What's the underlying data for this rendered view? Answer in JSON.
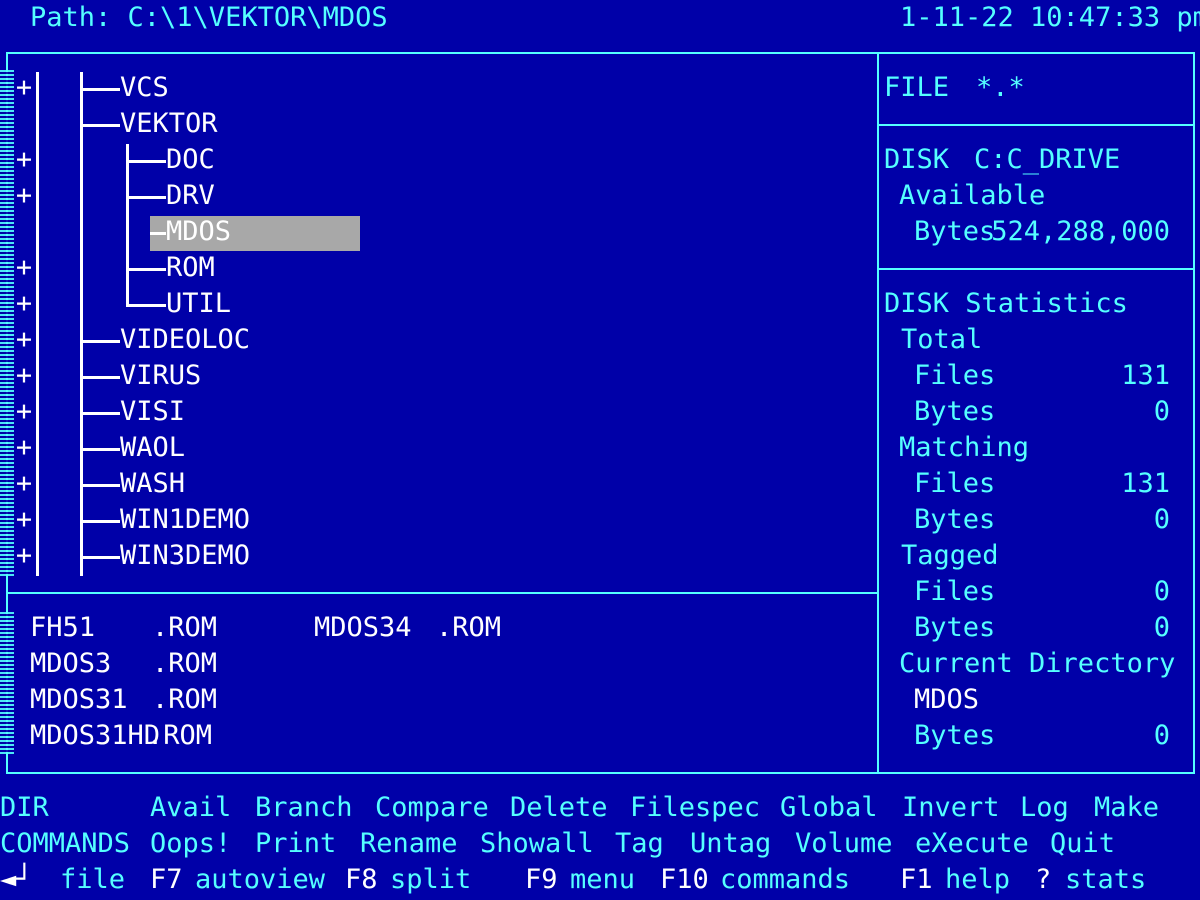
{
  "header": {
    "path_label": "Path: C:\\1\\VEKTOR\\MDOS",
    "datetime": "1-11-22 10:47:33 pm"
  },
  "tree": {
    "nodes": [
      {
        "label": "VCS",
        "plus": true
      },
      {
        "label": "VEKTOR",
        "plus": false
      },
      {
        "label": "DOC",
        "plus": true
      },
      {
        "label": "DRV",
        "plus": true
      },
      {
        "label": "MDOS",
        "plus": false,
        "selected": true
      },
      {
        "label": "ROM",
        "plus": true
      },
      {
        "label": "UTIL",
        "plus": true
      },
      {
        "label": "VIDEOLOC",
        "plus": true
      },
      {
        "label": "VIRUS",
        "plus": true
      },
      {
        "label": "VISI",
        "plus": true
      },
      {
        "label": "WAOL",
        "plus": true
      },
      {
        "label": "WASH",
        "plus": true
      },
      {
        "label": "WIN1DEMO",
        "plus": true
      },
      {
        "label": "WIN3DEMO",
        "plus": true
      }
    ],
    "plus_glyph": "+"
  },
  "files": [
    {
      "name": "FH51",
      "ext": ".ROM"
    },
    {
      "name": "MDOS3",
      "ext": ".ROM"
    },
    {
      "name": "MDOS31",
      "ext": ".ROM"
    },
    {
      "name": "MDOS31HD",
      "ext": ".ROM"
    },
    {
      "name": "MDOS34",
      "ext": ".ROM"
    }
  ],
  "info": {
    "file_label": "FILE",
    "file_spec": "*.*",
    "disk_label": "DISK",
    "disk_name": "C:C_DRIVE",
    "available_label": "Available",
    "bytes_label": "Bytes",
    "available_bytes": "524,288,000",
    "stats_title": "DISK Statistics",
    "total_label": "Total",
    "files_label": "Files",
    "total_files": "131",
    "total_bytes": "0",
    "matching_label": "Matching",
    "matching_files": "131",
    "matching_bytes": "0",
    "tagged_label": "Tagged",
    "tagged_files": "0",
    "tagged_bytes": "0",
    "current_dir_label": "Current Directory",
    "current_dir": "MDOS",
    "current_bytes": "0"
  },
  "menu": {
    "row1_label": "DIR",
    "row2_label": "COMMANDS",
    "row1": [
      "Avail",
      "Branch",
      "Compare",
      "Delete",
      "Filespec",
      "Global",
      "Invert",
      "Log",
      "Make"
    ],
    "row2": [
      "Oops!",
      "Print",
      "Rename",
      "Showall",
      "Tag",
      "Untag",
      "Volume",
      "eXecute",
      "Quit"
    ],
    "enter_glyph": "◄┘",
    "enter_label": "file",
    "f7": "F7",
    "f7_label": "autoview",
    "f8": "F8",
    "f8_label": "split",
    "f9": "F9",
    "f9_label": "menu",
    "f10": "F10",
    "f10_label": "commands",
    "f1": "F1",
    "f1_label": "help",
    "q": "?",
    "q_label": "stats"
  },
  "colors": {
    "background": "#0000a8",
    "text": "#ffffff",
    "accent": "#55ffff",
    "selection": "#a8a8a8"
  }
}
